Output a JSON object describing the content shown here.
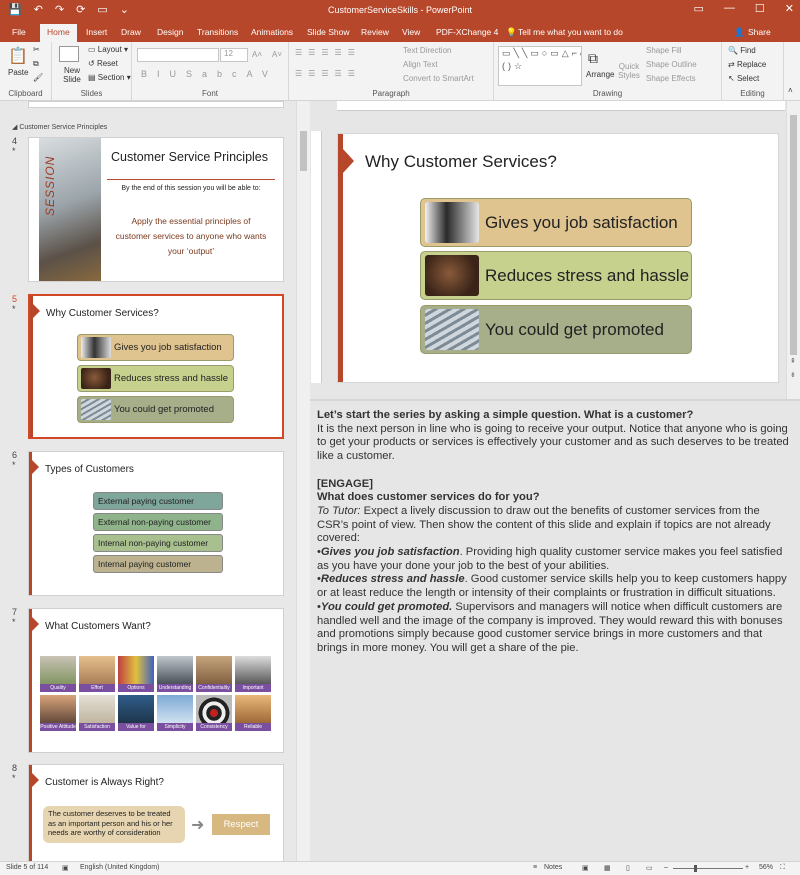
{
  "window": {
    "title": "CustomerServiceSkills - PowerPoint",
    "qat": [
      "💾",
      "↶",
      "↷",
      "⟳",
      "▭",
      "⌄"
    ],
    "controls": [
      "▭",
      "—",
      "☐",
      "✕"
    ]
  },
  "tabs": [
    "File",
    "Home",
    "Insert",
    "Draw",
    "Design",
    "Transitions",
    "Animations",
    "Slide Show",
    "Review",
    "View",
    "PDF-XChange 4"
  ],
  "tell_me": "Tell me what you want to do",
  "share": "Share",
  "ribbon": {
    "clipboard": {
      "paste": "Paste",
      "label": "Clipboard"
    },
    "slides": {
      "new_slide": "New Slide",
      "layout": "Layout",
      "reset": "Reset",
      "section": "Section",
      "label": "Slides"
    },
    "font": {
      "size": "12",
      "label": "Font"
    },
    "paragraph": {
      "text_direction": "Text Direction",
      "align_text": "Align Text",
      "convert": "Convert to SmartArt",
      "label": "Paragraph"
    },
    "drawing": {
      "shapes_preview": "▭╲╲▭○▭△⌐⌐⇨⇩⊡☆☐△▭⌐{}()☆",
      "arrange": "Arrange",
      "quick_styles": "Quick Styles",
      "shape_fill": "Shape Fill",
      "shape_outline": "Shape Outline",
      "shape_effects": "Shape Effects",
      "label": "Drawing"
    },
    "editing": {
      "find": "Find",
      "replace": "Replace",
      "select": "Select",
      "label": "Editing"
    }
  },
  "thumbnails": {
    "section_name": "Customer Service Principles",
    "slide4": {
      "num": "4",
      "title": "Customer Service Principles",
      "session": "SESSION",
      "intro": "By the end of this session you will be able to:",
      "body": "Apply the essential principles of customer services to anyone who wants your ‘output’"
    },
    "slide5": {
      "num": "5",
      "title": "Why Customer Services?",
      "items": [
        "Gives you job satisfaction",
        "Reduces stress and hassle",
        "You could get promoted"
      ]
    },
    "slide6": {
      "num": "6",
      "title": "Types of Customers",
      "items": [
        "External paying customer",
        "External non-paying customer",
        "Internal non-paying customer",
        "Internal paying customer"
      ]
    },
    "slide7": {
      "num": "7",
      "title": "What Customers Want?",
      "tiles": [
        "Quality",
        "Effort",
        "Options",
        "Understanding",
        "Confidentiality",
        "Important",
        "Positive Attitude",
        "Satisfaction",
        "Value for Money",
        "Simplicity",
        "Consistency",
        "Reliable"
      ]
    },
    "slide8": {
      "num": "8",
      "title": "Customer is Always Right?",
      "body": "The customer deserves to be treated as an important person and his or her needs are worthy of consideration",
      "respect": "Respect"
    }
  },
  "main_slide": {
    "title": "Why Customer Services?",
    "items": [
      "Gives you job satisfaction",
      "Reduces stress and hassle",
      "You could get promoted"
    ],
    "colors": [
      "#e0c490",
      "#c6d18e",
      "#a7ae8a"
    ]
  },
  "notes": {
    "q1": "Let’s start the series by asking a simple question. What is a customer?",
    "a1": "It is the next person in line who is going to receive your output. Notice that anyone who is going to get your products or services is effectively your customer and as such deserves to be treated like a customer.",
    "engage": "[ENGAGE]",
    "q2": "What does customer services do for you?",
    "tutor_label": "To Tutor:",
    "tutor": " Expect a lively discussion to draw out the benefits of customer services from the CSR’s point of view. Then show the content of this slide and explain if topics are not already covered:",
    "b1_head": "Gives you job satisfaction",
    "b1": ". Providing high quality customer service makes you feel satisfied as you have your done your job to the best of your abilities.",
    "b2_head": "Reduces stress and hassle",
    "b2": ". Good customer service skills help you to keep customers happy or at least reduce the length or intensity of their complaints or frustration in difficult situations.",
    "b3_head": "You could get promoted.",
    "b3": " Supervisors and managers will notice when difficult customers are handled well and the image of the company is improved. They would reward this with bonuses and promotions simply because good customer service brings in more customers and that brings in more money. You will get a share of the pie.",
    "bullet": "•"
  },
  "status": {
    "slide_of": "Slide 5 of 114",
    "language": "English (United Kingdom)",
    "notes_btn": "Notes",
    "zoom": "56%",
    "minus": "–",
    "plus": "+"
  }
}
